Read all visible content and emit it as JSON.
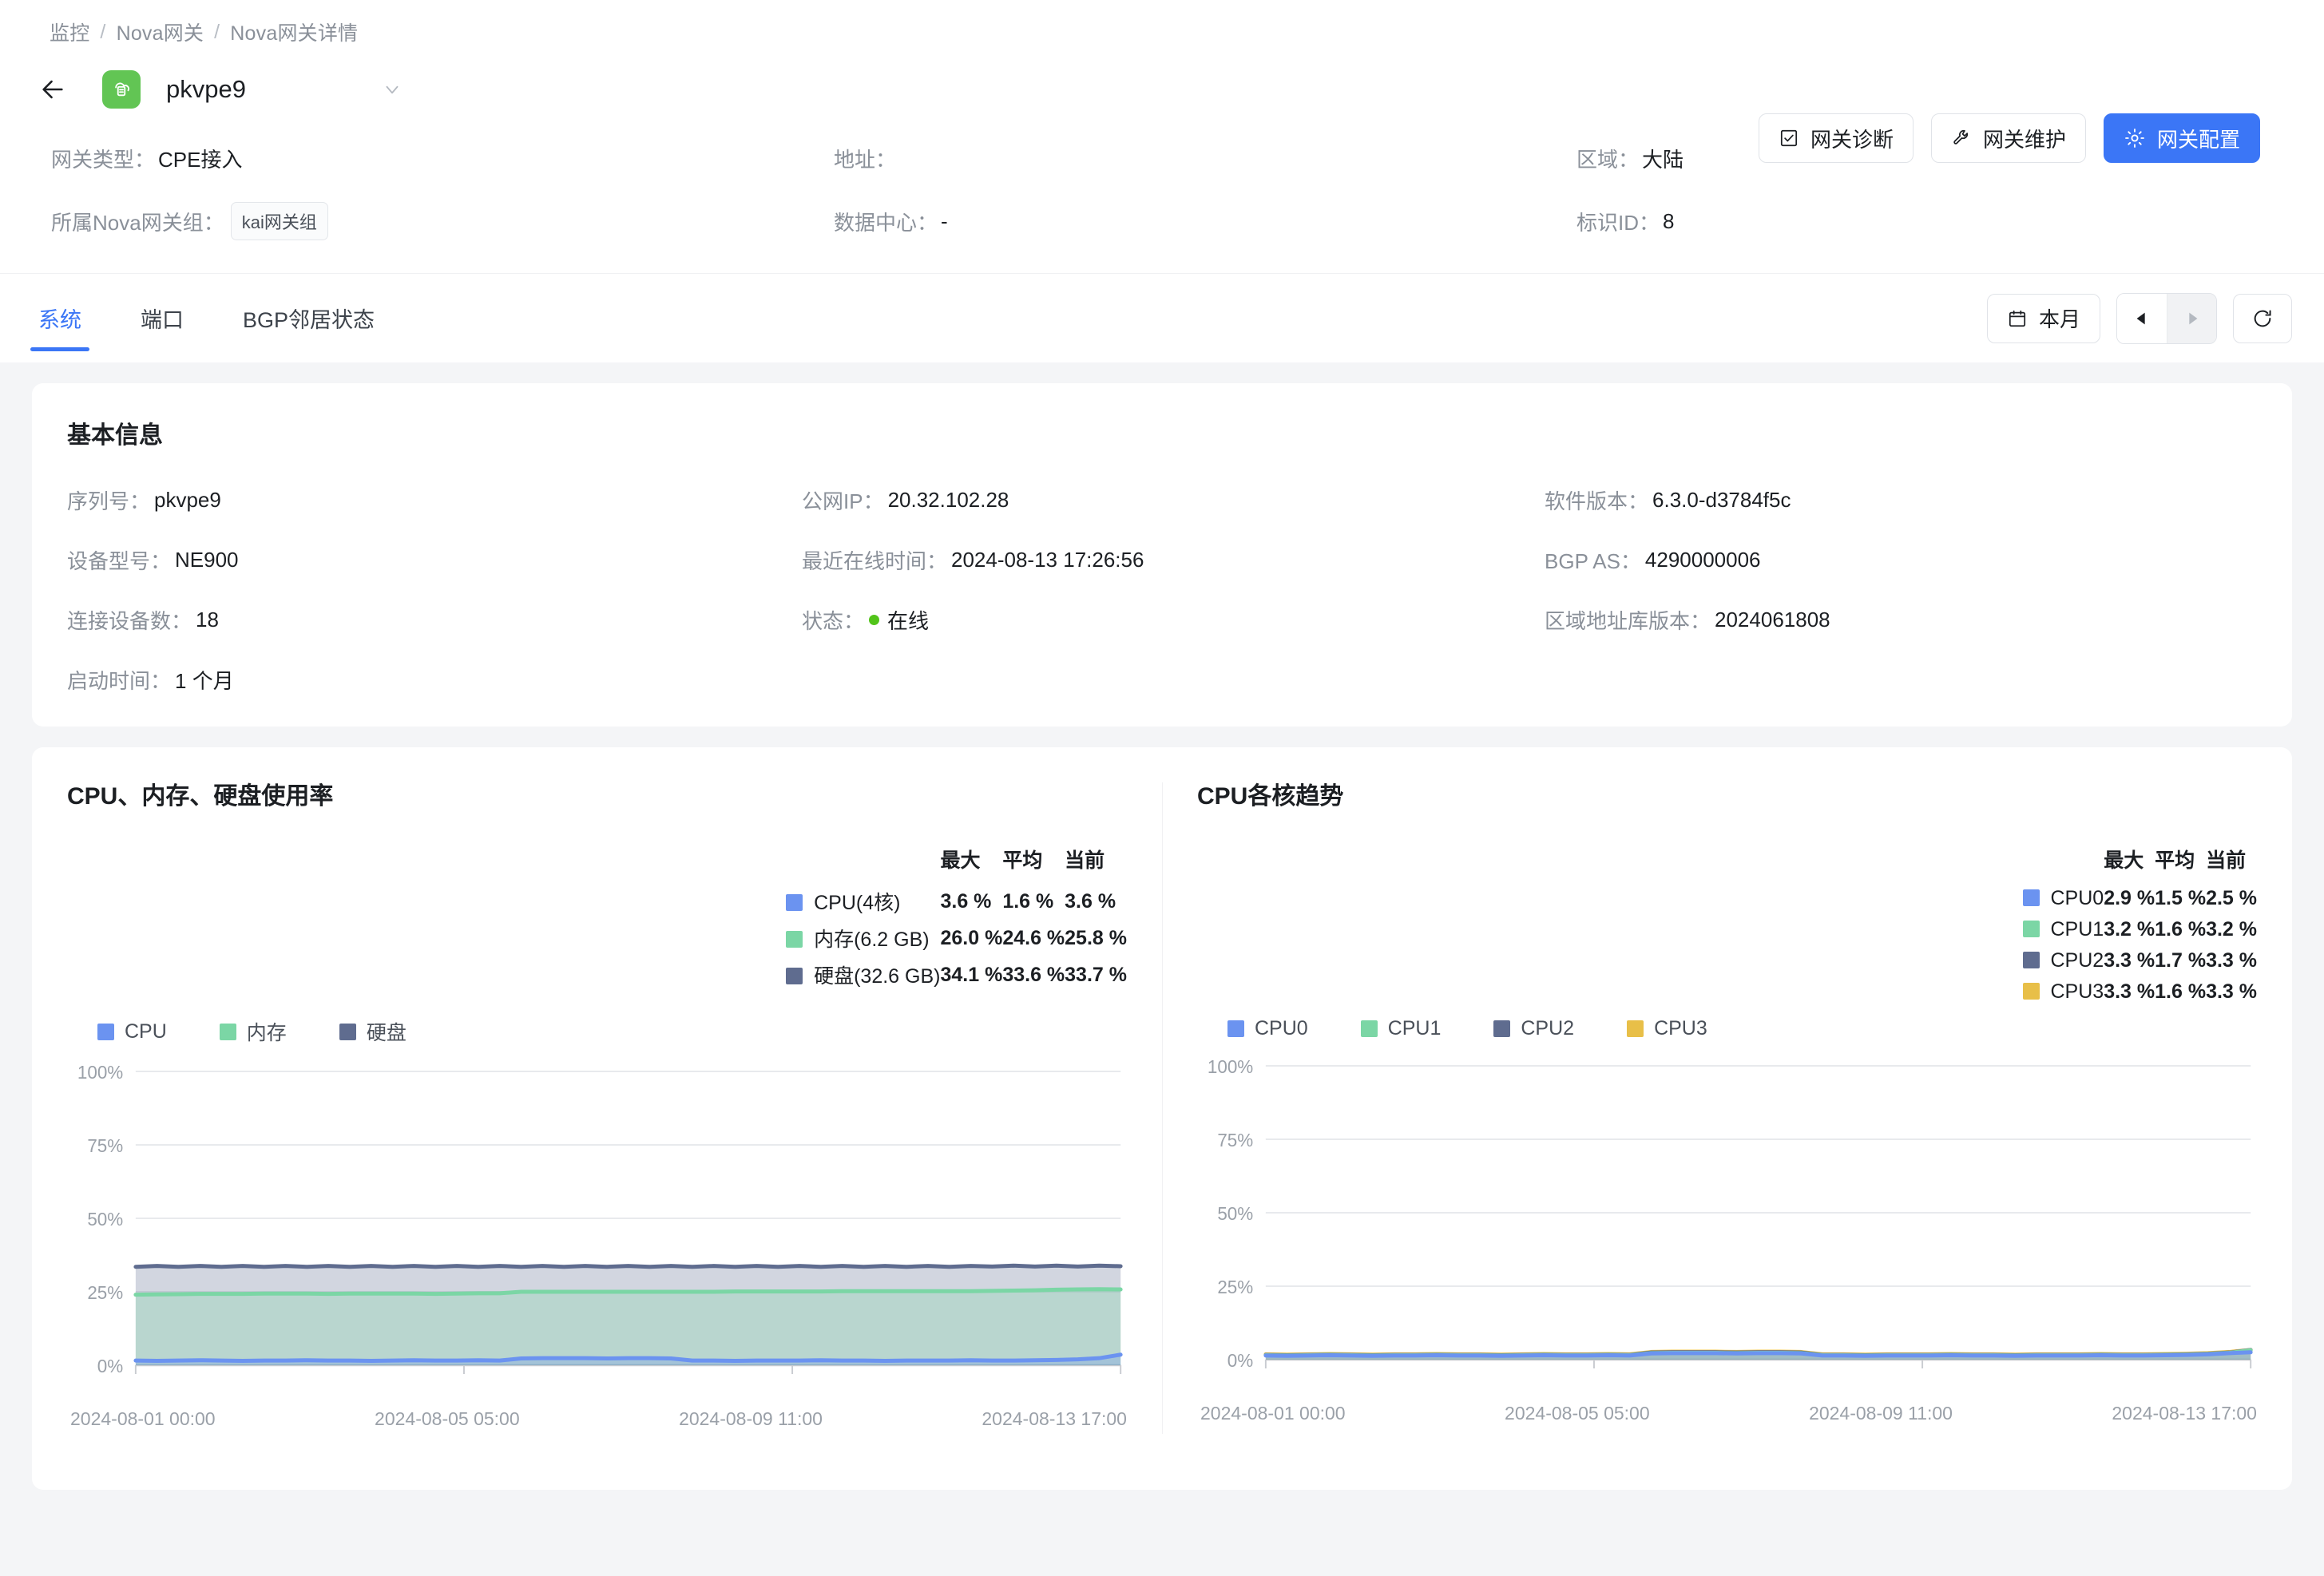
{
  "breadcrumb": {
    "items": [
      "监控",
      "Nova网关",
      "Nova网关详情"
    ],
    "separator": "/"
  },
  "header": {
    "back_icon": "arrow-left-icon",
    "gateway_icon": "cloud-gateway-icon",
    "gateway_name": "pkvpe9",
    "dropdown_icon": "chevron-down-icon",
    "actions": [
      {
        "label": "网关诊断",
        "icon": "checkbox-icon",
        "primary": false
      },
      {
        "label": "网关维护",
        "icon": "wrench-icon",
        "primary": false
      },
      {
        "label": "网关配置",
        "icon": "gear-icon",
        "primary": true
      }
    ],
    "meta": [
      {
        "label": "网关类型：",
        "value": "CPE接入"
      },
      {
        "label": "地址：",
        "value": ""
      },
      {
        "label": "区域：",
        "value": "大陆"
      },
      {
        "label": "所属Nova网关组：",
        "value": "",
        "tag": "kai网关组"
      },
      {
        "label": "数据中心：",
        "value": "-"
      },
      {
        "label": "标识ID：",
        "value": "8"
      }
    ]
  },
  "tabs": [
    {
      "label": "系统",
      "active": true
    },
    {
      "label": "端口",
      "active": false
    },
    {
      "label": "BGP邻居状态",
      "active": false
    }
  ],
  "toolbar": {
    "range_label": "本月",
    "calendar_icon": "calendar-icon",
    "prev_icon": "triangle-left-icon",
    "next_icon": "triangle-right-icon",
    "refresh_icon": "refresh-icon"
  },
  "basic_info": {
    "title": "基本信息",
    "items": [
      {
        "label": "序列号：",
        "value": "pkvpe9"
      },
      {
        "label": "公网IP：",
        "value": "20.32.102.28"
      },
      {
        "label": "软件版本：",
        "value": "6.3.0-d3784f5c"
      },
      {
        "label": "设备型号：",
        "value": "NE900"
      },
      {
        "label": "最近在线时间：",
        "value": "2024-08-13 17:26:56"
      },
      {
        "label": "BGP AS：",
        "value": "4290000006"
      },
      {
        "label": "连接设备数：",
        "value": "18"
      },
      {
        "label": "状态：",
        "value": "在线",
        "status_dot": "#52c41a"
      },
      {
        "label": "区域地址库版本：",
        "value": "2024061808"
      },
      {
        "label": "启动时间：",
        "value": "1 个月"
      }
    ]
  },
  "chart_data": [
    {
      "type": "area",
      "title": "CPU、内存、硬盘使用率",
      "xlabel": "",
      "ylabel": "",
      "ylim": [
        0,
        100
      ],
      "ytick_labels": [
        "100%",
        "75%",
        "50%",
        "25%",
        "0%"
      ],
      "xtick_labels": [
        "2024-08-01 00:00",
        "2024-08-05 05:00",
        "2024-08-09 11:00",
        "2024-08-13 17:00"
      ],
      "grid": true,
      "legend_position": "top",
      "legend": [
        "CPU",
        "内存",
        "硬盘"
      ],
      "stats_headers": [
        "最大",
        "平均",
        "当前"
      ],
      "series": [
        {
          "name": "CPU(4核)",
          "legend": "CPU",
          "color": "#6b93f0",
          "max": "3.6 %",
          "avg": "1.6 %",
          "current": "3.6 %",
          "values": [
            1.6,
            1.5,
            1.6,
            1.7,
            1.6,
            1.5,
            1.6,
            1.6,
            1.7,
            1.6,
            1.6,
            1.5,
            1.6,
            1.7,
            1.6,
            1.6,
            1.7,
            1.6,
            2.3,
            2.4,
            2.4,
            2.4,
            2.3,
            2.4,
            2.4,
            2.3,
            1.6,
            1.6,
            1.5,
            1.6,
            1.6,
            1.6,
            1.7,
            1.6,
            1.6,
            1.5,
            1.6,
            1.6,
            1.6,
            1.7,
            1.6,
            1.6,
            1.7,
            1.8,
            2.0,
            2.4,
            3.6
          ]
        },
        {
          "name": "内存(6.2 GB)",
          "legend": "内存",
          "color": "#7bd6a5",
          "max": "26.0 %",
          "avg": "24.6 %",
          "current": "25.8 %",
          "values": [
            24.0,
            24.1,
            24.2,
            24.3,
            24.3,
            24.3,
            24.4,
            24.4,
            24.4,
            24.3,
            24.4,
            24.4,
            24.4,
            24.4,
            24.3,
            24.4,
            24.5,
            24.5,
            25.0,
            25.0,
            25.0,
            25.0,
            25.0,
            25.0,
            25.0,
            25.0,
            25.0,
            25.0,
            25.1,
            25.1,
            25.1,
            25.1,
            25.1,
            25.2,
            25.2,
            25.2,
            25.2,
            25.2,
            25.2,
            25.2,
            25.3,
            25.4,
            25.5,
            25.7,
            25.8,
            25.9,
            25.8
          ]
        },
        {
          "name": "硬盘(32.6 GB)",
          "legend": "硬盘",
          "color": "#5f6c8f",
          "max": "34.1 %",
          "avg": "33.6 %",
          "current": "33.7 %",
          "values": [
            33.5,
            33.8,
            33.5,
            33.8,
            33.5,
            33.8,
            33.5,
            33.8,
            33.5,
            33.8,
            33.5,
            33.8,
            33.5,
            33.8,
            33.5,
            33.8,
            33.5,
            33.8,
            33.5,
            33.8,
            33.5,
            33.8,
            33.5,
            33.8,
            33.5,
            33.8,
            33.5,
            33.8,
            33.5,
            33.8,
            33.5,
            33.8,
            33.5,
            33.8,
            33.5,
            33.8,
            33.5,
            33.8,
            33.5,
            33.8,
            33.6,
            33.9,
            33.6,
            33.9,
            33.6,
            33.9,
            33.7
          ]
        }
      ]
    },
    {
      "type": "area",
      "title": "CPU各核趋势",
      "xlabel": "",
      "ylabel": "",
      "ylim": [
        0,
        100
      ],
      "ytick_labels": [
        "100%",
        "75%",
        "50%",
        "25%",
        "0%"
      ],
      "xtick_labels": [
        "2024-08-01 00:00",
        "2024-08-05 05:00",
        "2024-08-09 11:00",
        "2024-08-13 17:00"
      ],
      "grid": true,
      "legend_position": "top",
      "legend": [
        "CPU0",
        "CPU1",
        "CPU2",
        "CPU3"
      ],
      "stats_headers": [
        "最大",
        "平均",
        "当前"
      ],
      "series": [
        {
          "name": "CPU0",
          "legend": "CPU0",
          "color": "#6b93f0",
          "max": "2.9 %",
          "avg": "1.5 %",
          "current": "2.5 %",
          "values": [
            1.4,
            1.3,
            1.4,
            1.5,
            1.4,
            1.3,
            1.4,
            1.4,
            1.5,
            1.4,
            1.4,
            1.3,
            1.4,
            1.5,
            1.4,
            1.4,
            1.5,
            1.4,
            2.1,
            2.2,
            2.2,
            2.2,
            2.1,
            2.2,
            2.2,
            2.1,
            1.4,
            1.4,
            1.3,
            1.4,
            1.4,
            1.4,
            1.5,
            1.4,
            1.4,
            1.3,
            1.4,
            1.4,
            1.4,
            1.5,
            1.4,
            1.4,
            1.5,
            1.6,
            1.8,
            2.2,
            2.5
          ]
        },
        {
          "name": "CPU1",
          "legend": "CPU1",
          "color": "#7bd6a5",
          "max": "3.2 %",
          "avg": "1.6 %",
          "current": "3.2 %",
          "values": [
            1.5,
            1.4,
            1.5,
            1.6,
            1.5,
            1.4,
            1.5,
            1.5,
            1.6,
            1.5,
            1.5,
            1.4,
            1.5,
            1.6,
            1.5,
            1.5,
            1.6,
            1.5,
            2.2,
            2.3,
            2.3,
            2.3,
            2.2,
            2.3,
            2.3,
            2.2,
            1.5,
            1.5,
            1.4,
            1.5,
            1.5,
            1.5,
            1.6,
            1.5,
            1.5,
            1.4,
            1.5,
            1.5,
            1.5,
            1.6,
            1.5,
            1.5,
            1.6,
            1.7,
            1.9,
            2.3,
            3.2
          ]
        },
        {
          "name": "CPU2",
          "legend": "CPU2",
          "color": "#5f6c8f",
          "max": "3.3 %",
          "avg": "1.7 %",
          "current": "3.3 %",
          "values": [
            1.6,
            1.5,
            1.6,
            1.7,
            1.6,
            1.5,
            1.6,
            1.6,
            1.7,
            1.6,
            1.6,
            1.5,
            1.6,
            1.7,
            1.6,
            1.6,
            1.7,
            1.6,
            2.4,
            2.5,
            2.5,
            2.5,
            2.4,
            2.5,
            2.5,
            2.4,
            1.6,
            1.6,
            1.5,
            1.6,
            1.6,
            1.6,
            1.7,
            1.6,
            1.6,
            1.5,
            1.6,
            1.6,
            1.6,
            1.7,
            1.6,
            1.6,
            1.7,
            1.8,
            2.0,
            2.4,
            3.3
          ]
        },
        {
          "name": "CPU3",
          "legend": "CPU3",
          "color": "#e8bf48",
          "max": "3.3 %",
          "avg": "1.6 %",
          "current": "3.3 %",
          "values": [
            1.8,
            1.7,
            1.8,
            1.9,
            1.8,
            1.7,
            1.8,
            1.8,
            1.9,
            1.8,
            1.8,
            1.7,
            1.8,
            1.9,
            1.8,
            1.8,
            1.9,
            1.8,
            2.6,
            2.7,
            2.7,
            2.7,
            2.6,
            2.7,
            2.7,
            2.6,
            1.8,
            1.8,
            1.7,
            1.8,
            1.8,
            1.8,
            1.9,
            1.8,
            1.8,
            1.7,
            1.8,
            1.8,
            1.8,
            1.9,
            1.8,
            1.8,
            1.9,
            2.0,
            2.2,
            2.6,
            3.3
          ]
        }
      ]
    }
  ]
}
